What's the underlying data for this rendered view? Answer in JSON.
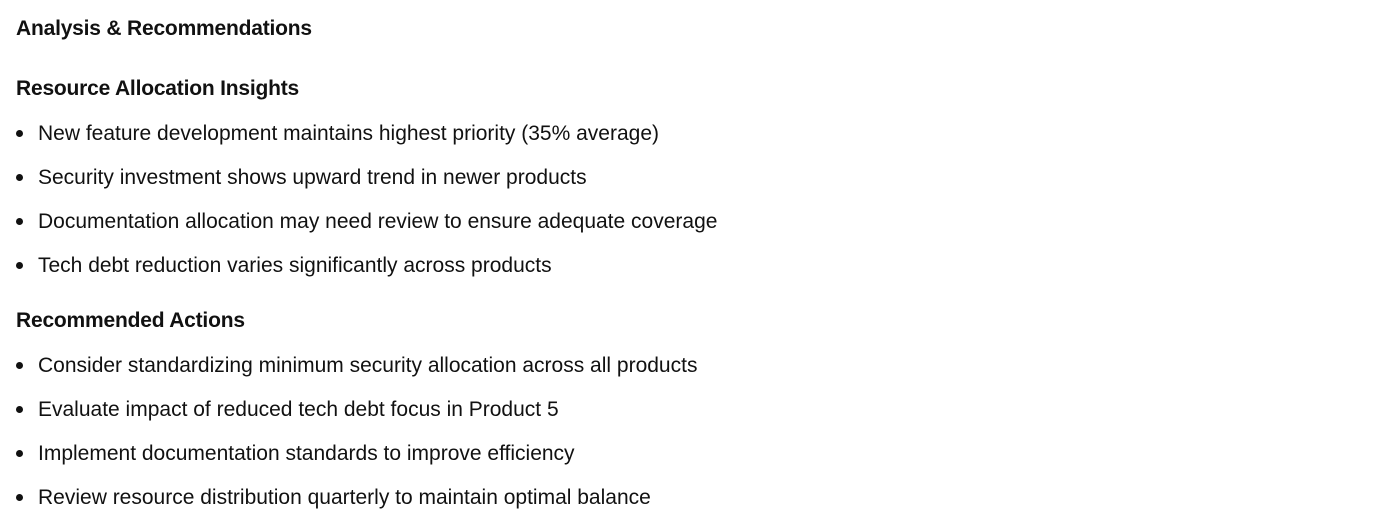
{
  "document": {
    "title": "Analysis & Recommendations",
    "sections": [
      {
        "heading": "Resource Allocation Insights",
        "items": [
          "New feature development maintains highest priority (35% average)",
          "Security investment shows upward trend in newer products",
          "Documentation allocation may need review to ensure adequate coverage",
          "Tech debt reduction varies significantly across products"
        ]
      },
      {
        "heading": "Recommended Actions",
        "items": [
          "Consider standardizing minimum security allocation across all products",
          "Evaluate impact of reduced tech debt focus in Product 5",
          "Implement documentation standards to improve efficiency",
          "Review resource distribution quarterly to maintain optimal balance"
        ]
      }
    ]
  }
}
